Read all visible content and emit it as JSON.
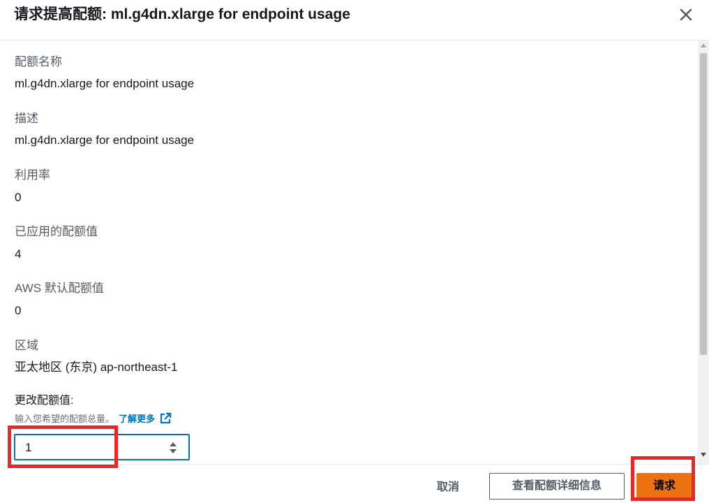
{
  "modal": {
    "title": "请求提高配额: ml.g4dn.xlarge for endpoint usage"
  },
  "fields": [
    {
      "label": "配额名称",
      "value": "ml.g4dn.xlarge for endpoint usage"
    },
    {
      "label": "描述",
      "value": "ml.g4dn.xlarge for endpoint usage"
    },
    {
      "label": "利用率",
      "value": "0"
    },
    {
      "label": "已应用的配额值",
      "value": "4"
    },
    {
      "label": "AWS 默认配额值",
      "value": "0"
    },
    {
      "label": "区域",
      "value": "亚太地区 (东京) ap-northeast-1"
    }
  ],
  "form": {
    "label": "更改配额值:",
    "hint": "输入您希望的配额总量。",
    "learn_more": "了解更多",
    "input_value": "1"
  },
  "footer": {
    "cancel": "取消",
    "view_details": "查看配额详细信息",
    "request": "请求"
  },
  "colors": {
    "accent": "#0073bb",
    "primary_button": "#ec7211",
    "highlight": "#e82727"
  },
  "icons": [
    "close-icon",
    "external-link-icon",
    "spinner-arrows-icon"
  ]
}
